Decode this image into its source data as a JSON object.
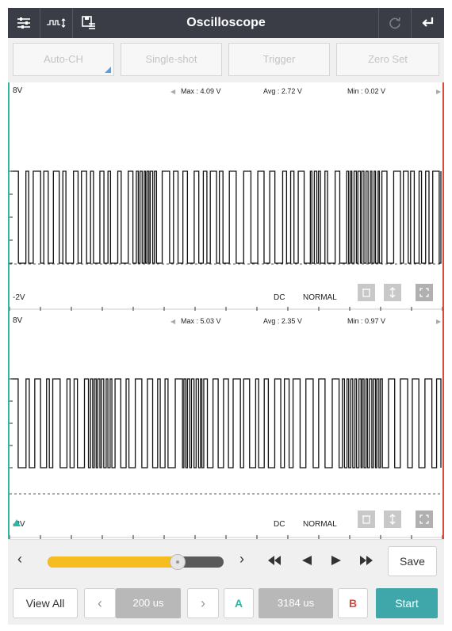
{
  "header": {
    "title": "Oscilloscope"
  },
  "modes": {
    "auto_ch": "Auto-CH",
    "single_shot": "Single-shot",
    "trigger": "Trigger",
    "zero_set": "Zero Set"
  },
  "channel1": {
    "top_voltage": "8V",
    "bottom_voltage": "-2V",
    "max": "Max : 4.09 V",
    "avg": "Avg : 2.72 V",
    "min": "Min : 0.02 V",
    "coupling": "DC",
    "mode": "NORMAL"
  },
  "channel2": {
    "top_voltage": "8V",
    "bottom_voltage": "-2V",
    "max": "Max : 5.03 V",
    "avg": "Avg : 2.35 V",
    "min": "Min : 0.97 V",
    "coupling": "DC",
    "mode": "NORMAL"
  },
  "slider": {
    "position": 0.74,
    "save_label": "Save"
  },
  "bottom": {
    "view_all": "View All",
    "timebase": "200 us",
    "cursor_a": "A",
    "cursor_value": "3184 us",
    "cursor_b": "B",
    "start": "Start"
  },
  "colors": {
    "header_bg": "#3a3d45",
    "accent_teal": "#3fa6a9",
    "cursor_a": "#2bb6a6",
    "cursor_b": "#d8493e",
    "slider_fill": "#f5bd1f"
  }
}
